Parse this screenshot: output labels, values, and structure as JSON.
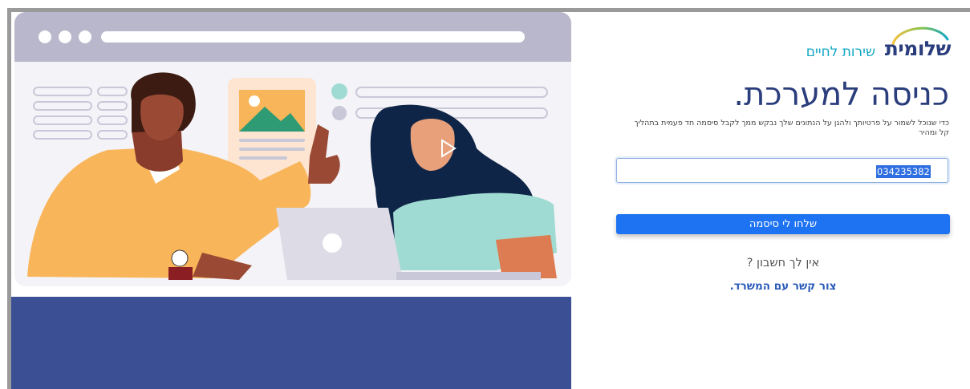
{
  "logo": {
    "name": "שלומית",
    "tagline": "שירות לחיים"
  },
  "login": {
    "title": "כניסה למערכת.",
    "subtitle": "כדי שנוכל לשמור על פרטיותך ולהגן על הנתונים שלך נבקש ממך לקבל סיסמה חד פעמית בתהליך קל ומהיר",
    "id_value": "034235382",
    "send_button": "שלחו לי סיסמה",
    "no_account": "אין לך חשבון ?",
    "contact_link": "צור קשר עם המשרד."
  },
  "colors": {
    "brand_navy": "#2a3d7c",
    "brand_teal": "#12a7c4",
    "button_blue": "#1e73f2",
    "illustration_bottom": "#3a4f94"
  },
  "icons": [
    "logo-arc-icon",
    "browser-dots-icon",
    "play-icon"
  ]
}
